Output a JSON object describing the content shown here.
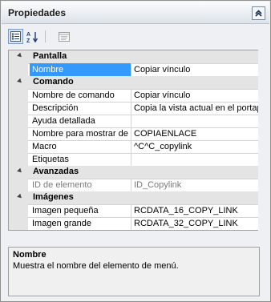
{
  "panel": {
    "title": "Propiedades"
  },
  "toolbar": [
    {
      "name": "categorized-view-button",
      "icon": "categorized-icon"
    },
    {
      "name": "alphabetical-sort-button",
      "icon": "sort-az-icon"
    },
    {
      "name": "property-pages-button",
      "icon": "property-pages-icon"
    }
  ],
  "grid": {
    "rows": [
      {
        "type": "category",
        "label": "Pantalla"
      },
      {
        "type": "property",
        "name": "Nombre",
        "value": "Copiar vínculo",
        "selected": true
      },
      {
        "type": "category",
        "label": "Comando"
      },
      {
        "type": "property",
        "name": "Nombre de comando",
        "value": "Copiar vínculo"
      },
      {
        "type": "property",
        "name": "Descripción",
        "value": "Copia la vista actual en el portapa"
      },
      {
        "type": "property",
        "name": "Ayuda detallada",
        "value": ""
      },
      {
        "type": "property",
        "name": "Nombre para mostrar de",
        "value": "COPIAENLACE"
      },
      {
        "type": "property",
        "name": "Macro",
        "value": "^C^C_copylink"
      },
      {
        "type": "property",
        "name": "Etiquetas",
        "value": ""
      },
      {
        "type": "category",
        "label": "Avanzadas"
      },
      {
        "type": "property",
        "name": "ID de elemento",
        "value": "ID_Copylink",
        "readonly": true
      },
      {
        "type": "category",
        "label": "Imágenes"
      },
      {
        "type": "property",
        "name": "Imagen pequeña",
        "value": "RCDATA_16_COPY_LINK"
      },
      {
        "type": "property",
        "name": "Imagen grande",
        "value": "RCDATA_32_COPY_LINK"
      }
    ]
  },
  "description": {
    "title": "Nombre",
    "text": "Muestra el nombre del elemento de menú."
  }
}
